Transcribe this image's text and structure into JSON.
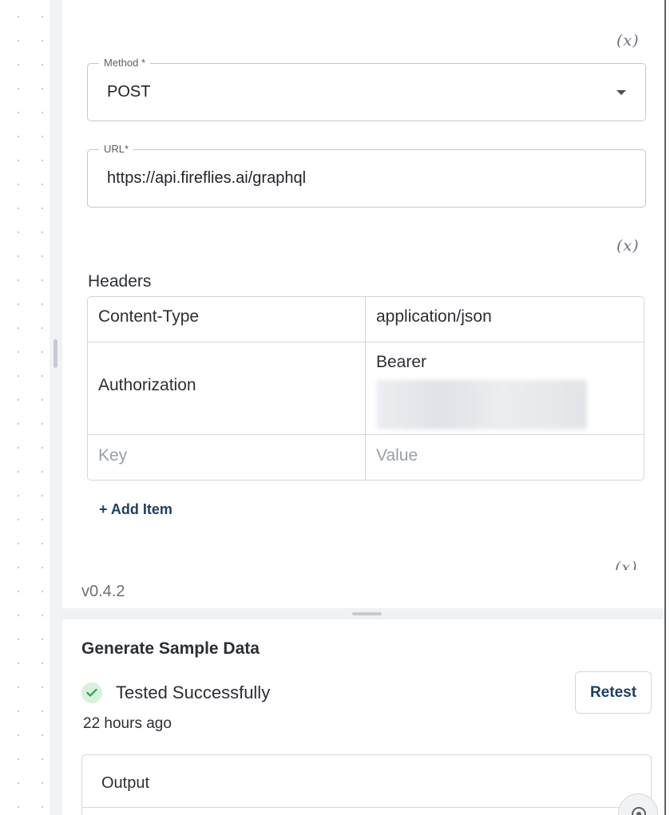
{
  "params": {
    "variable_toggle": "(x)",
    "method": {
      "label": "Method *",
      "value": "POST"
    },
    "url": {
      "label": "URL*",
      "value": "https://api.fireflies.ai/graphql"
    }
  },
  "headers": {
    "title": "Headers",
    "rows": [
      {
        "key": "Content-Type",
        "value": "application/json"
      },
      {
        "key": "Authorization",
        "value": "Bearer"
      }
    ],
    "key_placeholder": "Key",
    "value_placeholder": "Value",
    "add_item_label": "+ Add Item"
  },
  "version": "v0.4.2",
  "sample": {
    "title": "Generate Sample Data",
    "status": "Tested Successfully",
    "status_color": "#2e9e4f",
    "time_ago": "22 hours ago",
    "retest_label": "Retest",
    "output_label": "Output"
  }
}
